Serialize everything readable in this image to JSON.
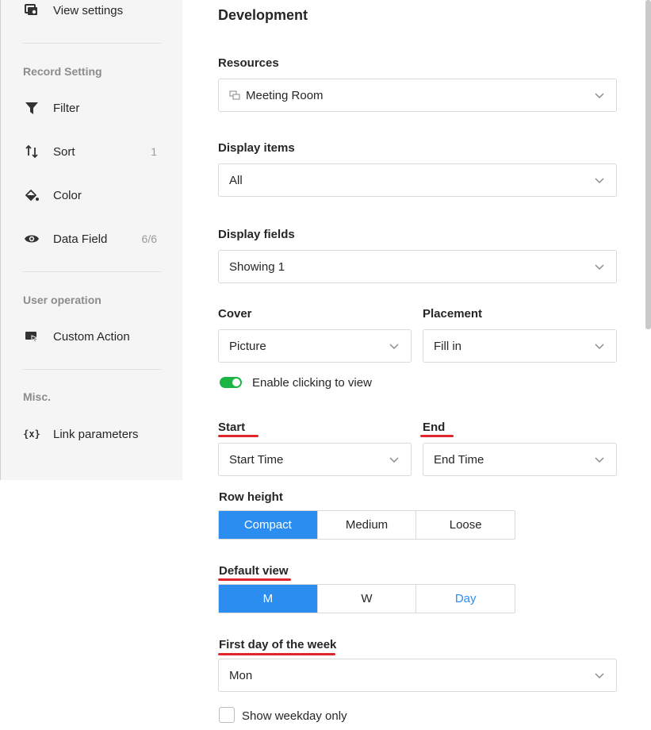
{
  "sidebar": {
    "view_settings": "View settings",
    "record_setting_heading": "Record Setting",
    "filter": "Filter",
    "sort": "Sort",
    "sort_count": "1",
    "color": "Color",
    "data_field": "Data Field",
    "data_field_count": "6/6",
    "user_operation_heading": "User operation",
    "custom_action": "Custom Action",
    "misc_heading": "Misc.",
    "link_parameters": "Link parameters"
  },
  "main": {
    "title": "Development",
    "resources_label": "Resources",
    "resources_value": "Meeting Room",
    "display_items_label": "Display items",
    "display_items_value": "All",
    "display_fields_label": "Display fields",
    "display_fields_value": "Showing 1",
    "cover_label": "Cover",
    "cover_value": "Picture",
    "placement_label": "Placement",
    "placement_value": "Fill in",
    "enable_clicking_label": "Enable clicking to view",
    "enable_clicking_on": true,
    "start_label": "Start",
    "start_value": "Start Time",
    "end_label": "End",
    "end_value": "End Time",
    "row_height_label": "Row height",
    "row_height_options": [
      "Compact",
      "Medium",
      "Loose"
    ],
    "row_height_selected": "Compact",
    "default_view_label": "Default view",
    "default_view_options": [
      "M",
      "W",
      "Day"
    ],
    "default_view_selected": "M",
    "first_day_label": "First day of the week",
    "first_day_value": "Mon",
    "show_weekday_only_label": "Show weekday only",
    "show_weekday_only_checked": false
  },
  "colors": {
    "accent": "#2b8def",
    "toggle_on": "#1db446",
    "annotation_underline": "#e0262b",
    "sidebar_bg": "#f5f5f5"
  },
  "icons": {
    "view_settings": "view-settings-icon",
    "filter": "filter-icon",
    "sort": "sort-icon",
    "color": "paint-bucket-icon",
    "data_field": "eye-icon",
    "custom_action": "custom-action-icon",
    "link_parameters": "variable-braces-icon"
  }
}
